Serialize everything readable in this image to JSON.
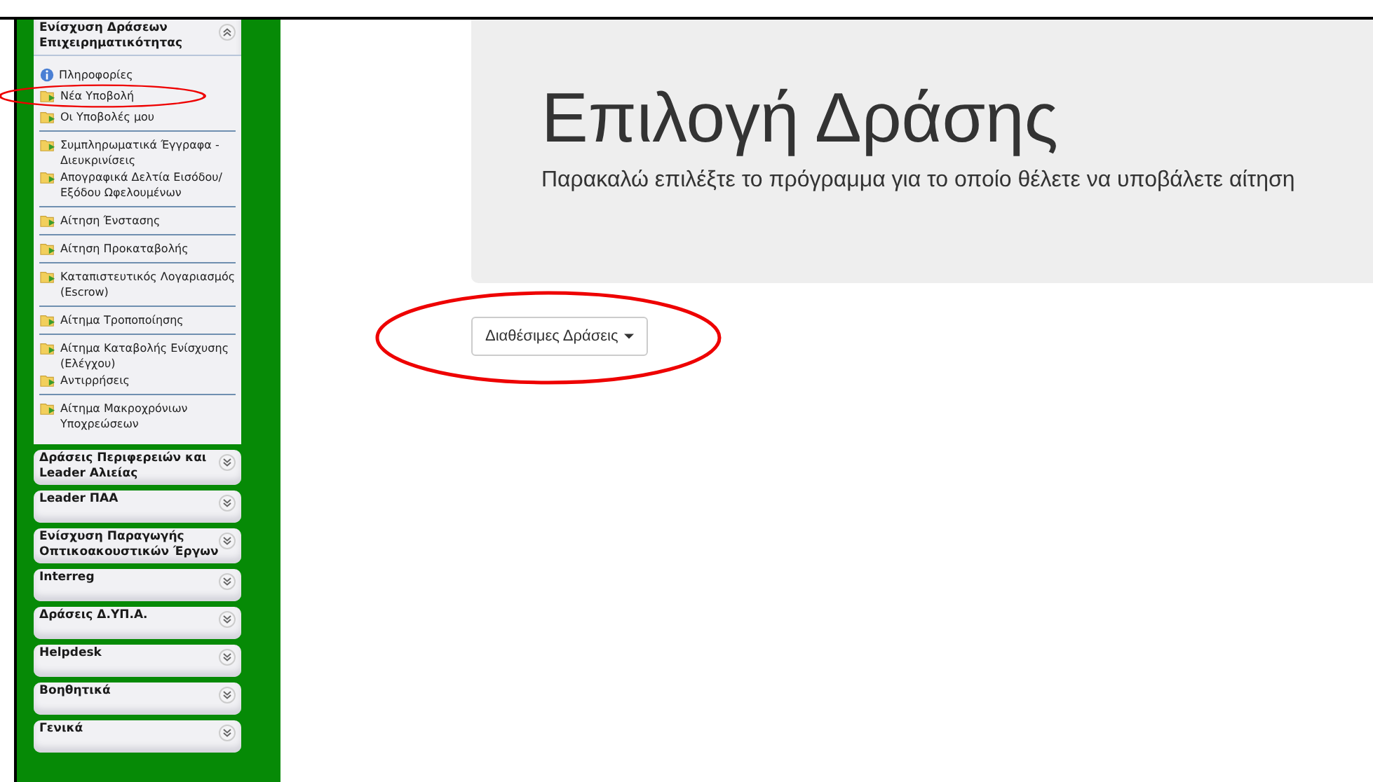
{
  "sidebar": {
    "sections": [
      {
        "title": "Ενίσχυση Δράσεων Επιχειρηματικότητας",
        "expanded": true,
        "groups": [
          [
            {
              "label": "Πληροφορίες",
              "kind": "info",
              "highlighted": false
            },
            {
              "label": "Νέα Υποβολή",
              "kind": "folder",
              "highlighted": true
            },
            {
              "label": "Οι Υποβολές μου",
              "kind": "folder",
              "highlighted": false
            }
          ],
          [
            {
              "label": "Συμπληρωματικά Έγγραφα - Διευκρινίσεις",
              "kind": "folder",
              "highlighted": false
            },
            {
              "label": "Απογραφικά Δελτία Εισόδου/ Εξόδου Ωφελουμένων",
              "kind": "folder",
              "highlighted": false
            }
          ],
          [
            {
              "label": "Αίτηση Ένστασης",
              "kind": "folder",
              "highlighted": false
            }
          ],
          [
            {
              "label": "Αίτηση Προκαταβολής",
              "kind": "folder",
              "highlighted": false
            }
          ],
          [
            {
              "label": "Καταπιστευτικός Λογαριασμός (Escrow)",
              "kind": "folder",
              "highlighted": false
            }
          ],
          [
            {
              "label": "Αίτημα Τροποποίησης",
              "kind": "folder",
              "highlighted": false
            }
          ],
          [
            {
              "label": "Αίτημα Καταβολής Ενίσχυσης (Ελέγχου)",
              "kind": "folder",
              "highlighted": false
            },
            {
              "label": "Αντιρρήσεις",
              "kind": "folder",
              "highlighted": false
            }
          ],
          [
            {
              "label": "Αίτημα Μακροχρόνιων Υποχρεώσεων",
              "kind": "folder",
              "highlighted": false
            }
          ]
        ]
      },
      {
        "title": "Δράσεις Περιφερειών και Leader Αλιείας",
        "expanded": false
      },
      {
        "title": "Leader ΠΑΑ",
        "expanded": false
      },
      {
        "title": "Ενίσχυση Παραγωγής Οπτικοακουστικών Έργων",
        "expanded": false
      },
      {
        "title": "Interreg",
        "expanded": false
      },
      {
        "title": "Δράσεις Δ.ΥΠ.Α.",
        "expanded": false
      },
      {
        "title": "Helpdesk",
        "expanded": false
      },
      {
        "title": "Βοηθητικά",
        "expanded": false
      },
      {
        "title": "Γενικά",
        "expanded": false
      }
    ]
  },
  "header": {
    "title": "Επιλογή Δράσης",
    "subtitle": "Παρακαλώ επιλέξτε το πρόγραμμα για το οποίο θέλετε να υποβάλετε αίτηση"
  },
  "dropdown": {
    "label": "Διαθέσιμες Δράσεις",
    "highlighted": true
  }
}
